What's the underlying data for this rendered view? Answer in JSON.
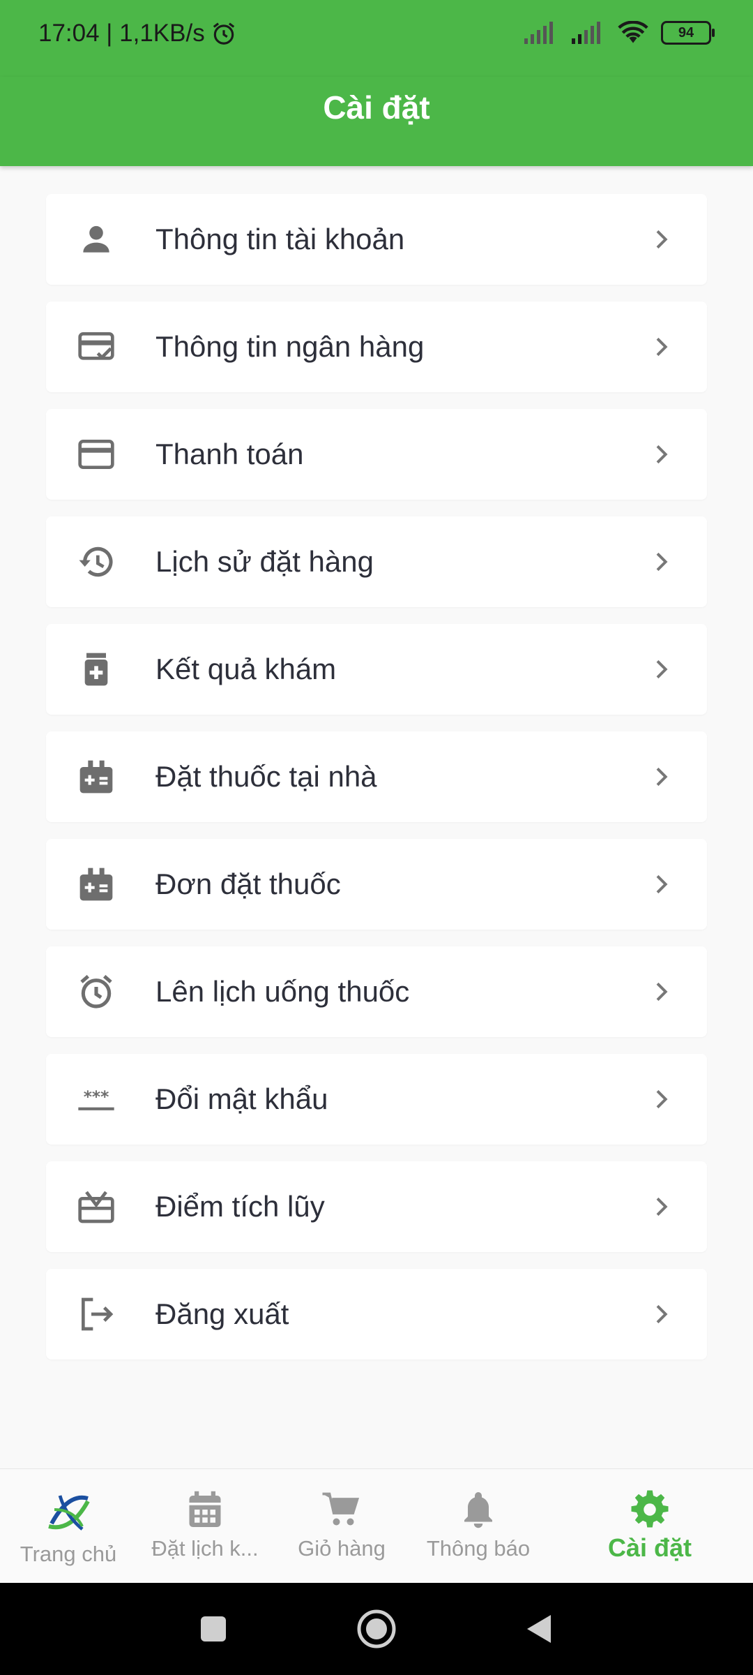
{
  "status_bar": {
    "time_net": "17:04 | 1,1KB/s",
    "battery": "94"
  },
  "header": {
    "title": "Cài đặt"
  },
  "menu": [
    {
      "label": "Thông tin tài khoản",
      "icon": "person-icon"
    },
    {
      "label": "Thông tin ngân hàng",
      "icon": "bank-card-check-icon"
    },
    {
      "label": "Thanh toán",
      "icon": "credit-card-icon"
    },
    {
      "label": "Lịch sử đặt hàng",
      "icon": "history-icon"
    },
    {
      "label": "Kết quả khám",
      "icon": "medicine-bottle-icon"
    },
    {
      "label": "Đặt thuốc tại nhà",
      "icon": "medical-kit-icon"
    },
    {
      "label": "Đơn đặt thuốc",
      "icon": "medical-kit-icon"
    },
    {
      "label": "Lên lịch uống thuốc",
      "icon": "alarm-clock-icon"
    },
    {
      "label": "Đổi mật khẩu",
      "icon": "password-icon"
    },
    {
      "label": "Điểm tích lũy",
      "icon": "gift-card-icon"
    },
    {
      "label": "Đăng xuất",
      "icon": "logout-icon"
    }
  ],
  "bottom_nav": {
    "home": "Trang chủ",
    "appointment": "Đặt lịch k...",
    "cart": "Giỏ hàng",
    "notifications": "Thông báo",
    "settings": "Cài đặt"
  },
  "colors": {
    "accent": "#4cb748",
    "text": "#2d2f3a",
    "icon": "#6e6e6e",
    "inactive": "#9a9a9a"
  }
}
